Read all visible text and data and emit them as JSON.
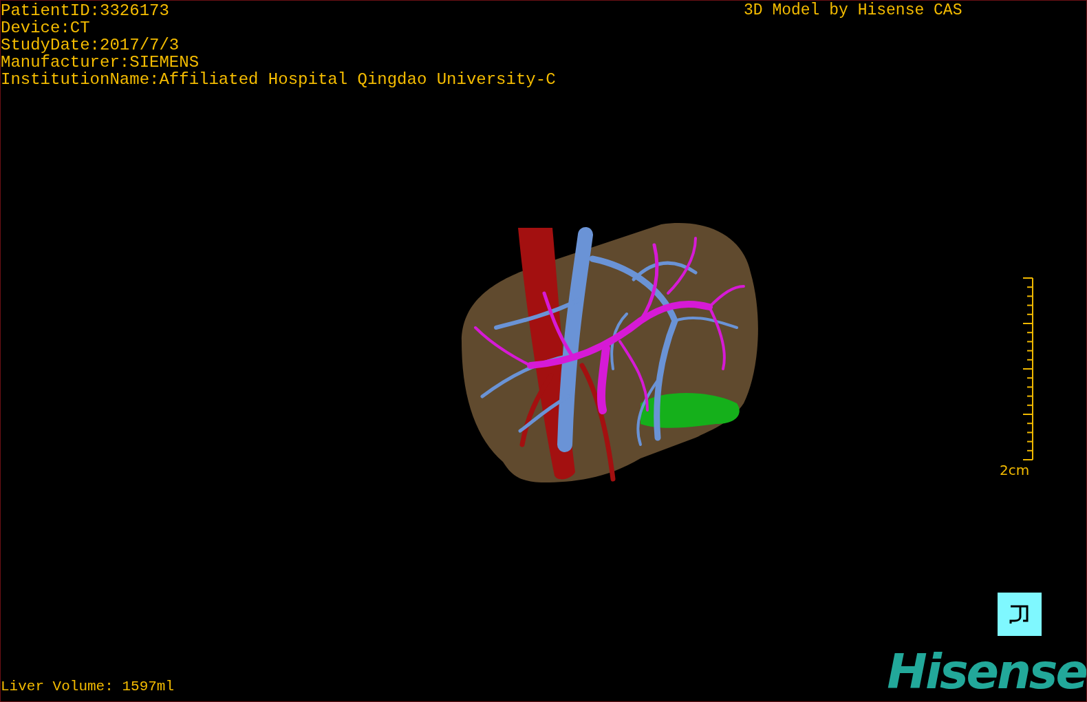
{
  "study_info": [
    "PatientID:3326173",
    "Device:CT",
    "StudyDate:2017/7/3",
    "Manufacturer:SIEMENS",
    "InstitutionName:Affiliated Hospital Qingdao University-C"
  ],
  "title": "3D Model by Hisense CAS",
  "scale_label": "2cm",
  "liver_volume": "Liver Volume: 1597ml",
  "logo": "Hisense"
}
